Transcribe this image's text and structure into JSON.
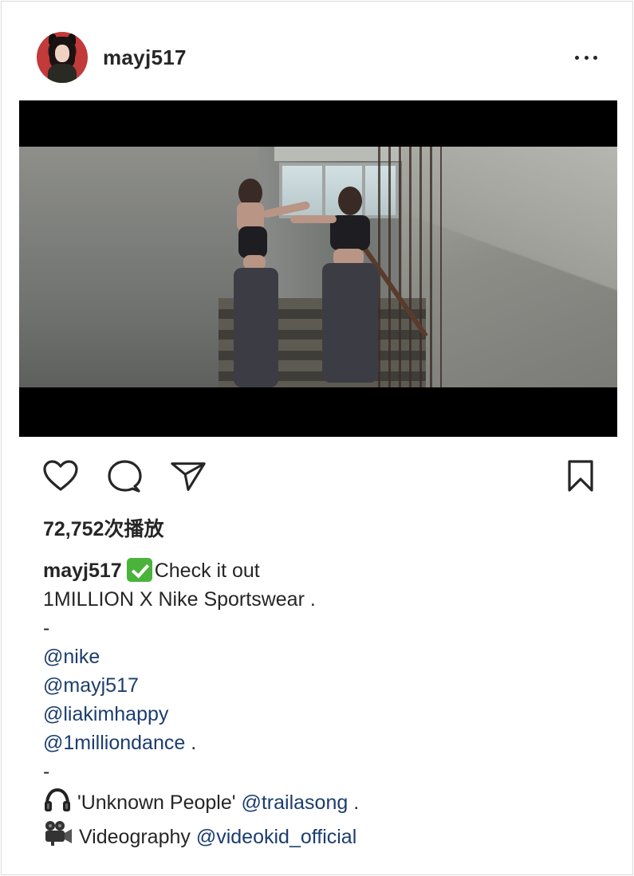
{
  "post": {
    "username": "mayj517",
    "views": "72,752次播放",
    "caption": {
      "owner": "mayj517",
      "headline": "Check it out",
      "line1": "1MILLION X Nike Sportswear .",
      "sep1": "-",
      "mentions": [
        "@nike",
        "@mayj517",
        "@liakimhappy",
        "@1milliondance"
      ],
      "mention_suffix": " .",
      "sep2": "-",
      "music_title": "'Unknown People'",
      "music_artist": "@trailasong",
      "music_suffix": " .",
      "video_label": "Videography",
      "video_credit": "@videokid_official"
    }
  },
  "icons": {
    "more": "more-horizontal-icon",
    "like": "heart-icon",
    "comment": "comment-icon",
    "share": "send-icon",
    "save": "bookmark-icon",
    "check": "check-mark-emoji",
    "music": "headphones-emoji",
    "video": "movie-camera-emoji"
  },
  "colors": {
    "text": "#262626",
    "mention": "#1b3d6e",
    "check": "#49b33a",
    "border": "#dbdbdb"
  }
}
